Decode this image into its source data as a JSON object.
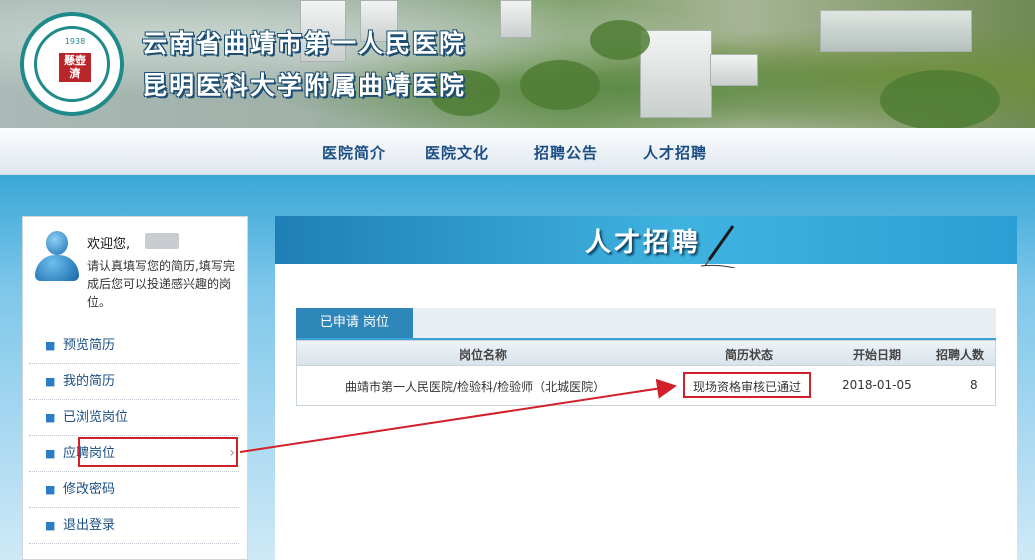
{
  "header": {
    "title_line1": "云南省曲靖市第一人民医院",
    "title_line2": "昆明医科大学附属曲靖医院",
    "logo_year": "1938",
    "logo_seal": "懸壺濟"
  },
  "nav": {
    "items": [
      "医院简介",
      "医院文化",
      "招聘公告",
      "人才招聘"
    ]
  },
  "sidebar": {
    "welcome": "欢迎您,",
    "hint": "请认真填写您的简历,填写完成后您可以投递感兴趣的岗位。",
    "items": [
      "预览简历",
      "我的简历",
      "已浏览岗位",
      "应聘岗位",
      "修改密码",
      "退出登录"
    ],
    "active_item": "应聘岗位"
  },
  "main": {
    "title": "人才招聘",
    "tab": "已申请 岗位",
    "table": {
      "headers": [
        "岗位名称",
        "简历状态",
        "开始日期",
        "招聘人数"
      ],
      "rows": [
        {
          "position": "曲靖市第一人民医院/检验科/检验师（北城医院）",
          "status": "现场资格审核已通过",
          "start_date": "2018-01-05",
          "count": "8"
        }
      ]
    }
  },
  "colors": {
    "accent": "#2e86b9",
    "annotation": "#d2202a",
    "nav_text": "#1a4e84"
  }
}
